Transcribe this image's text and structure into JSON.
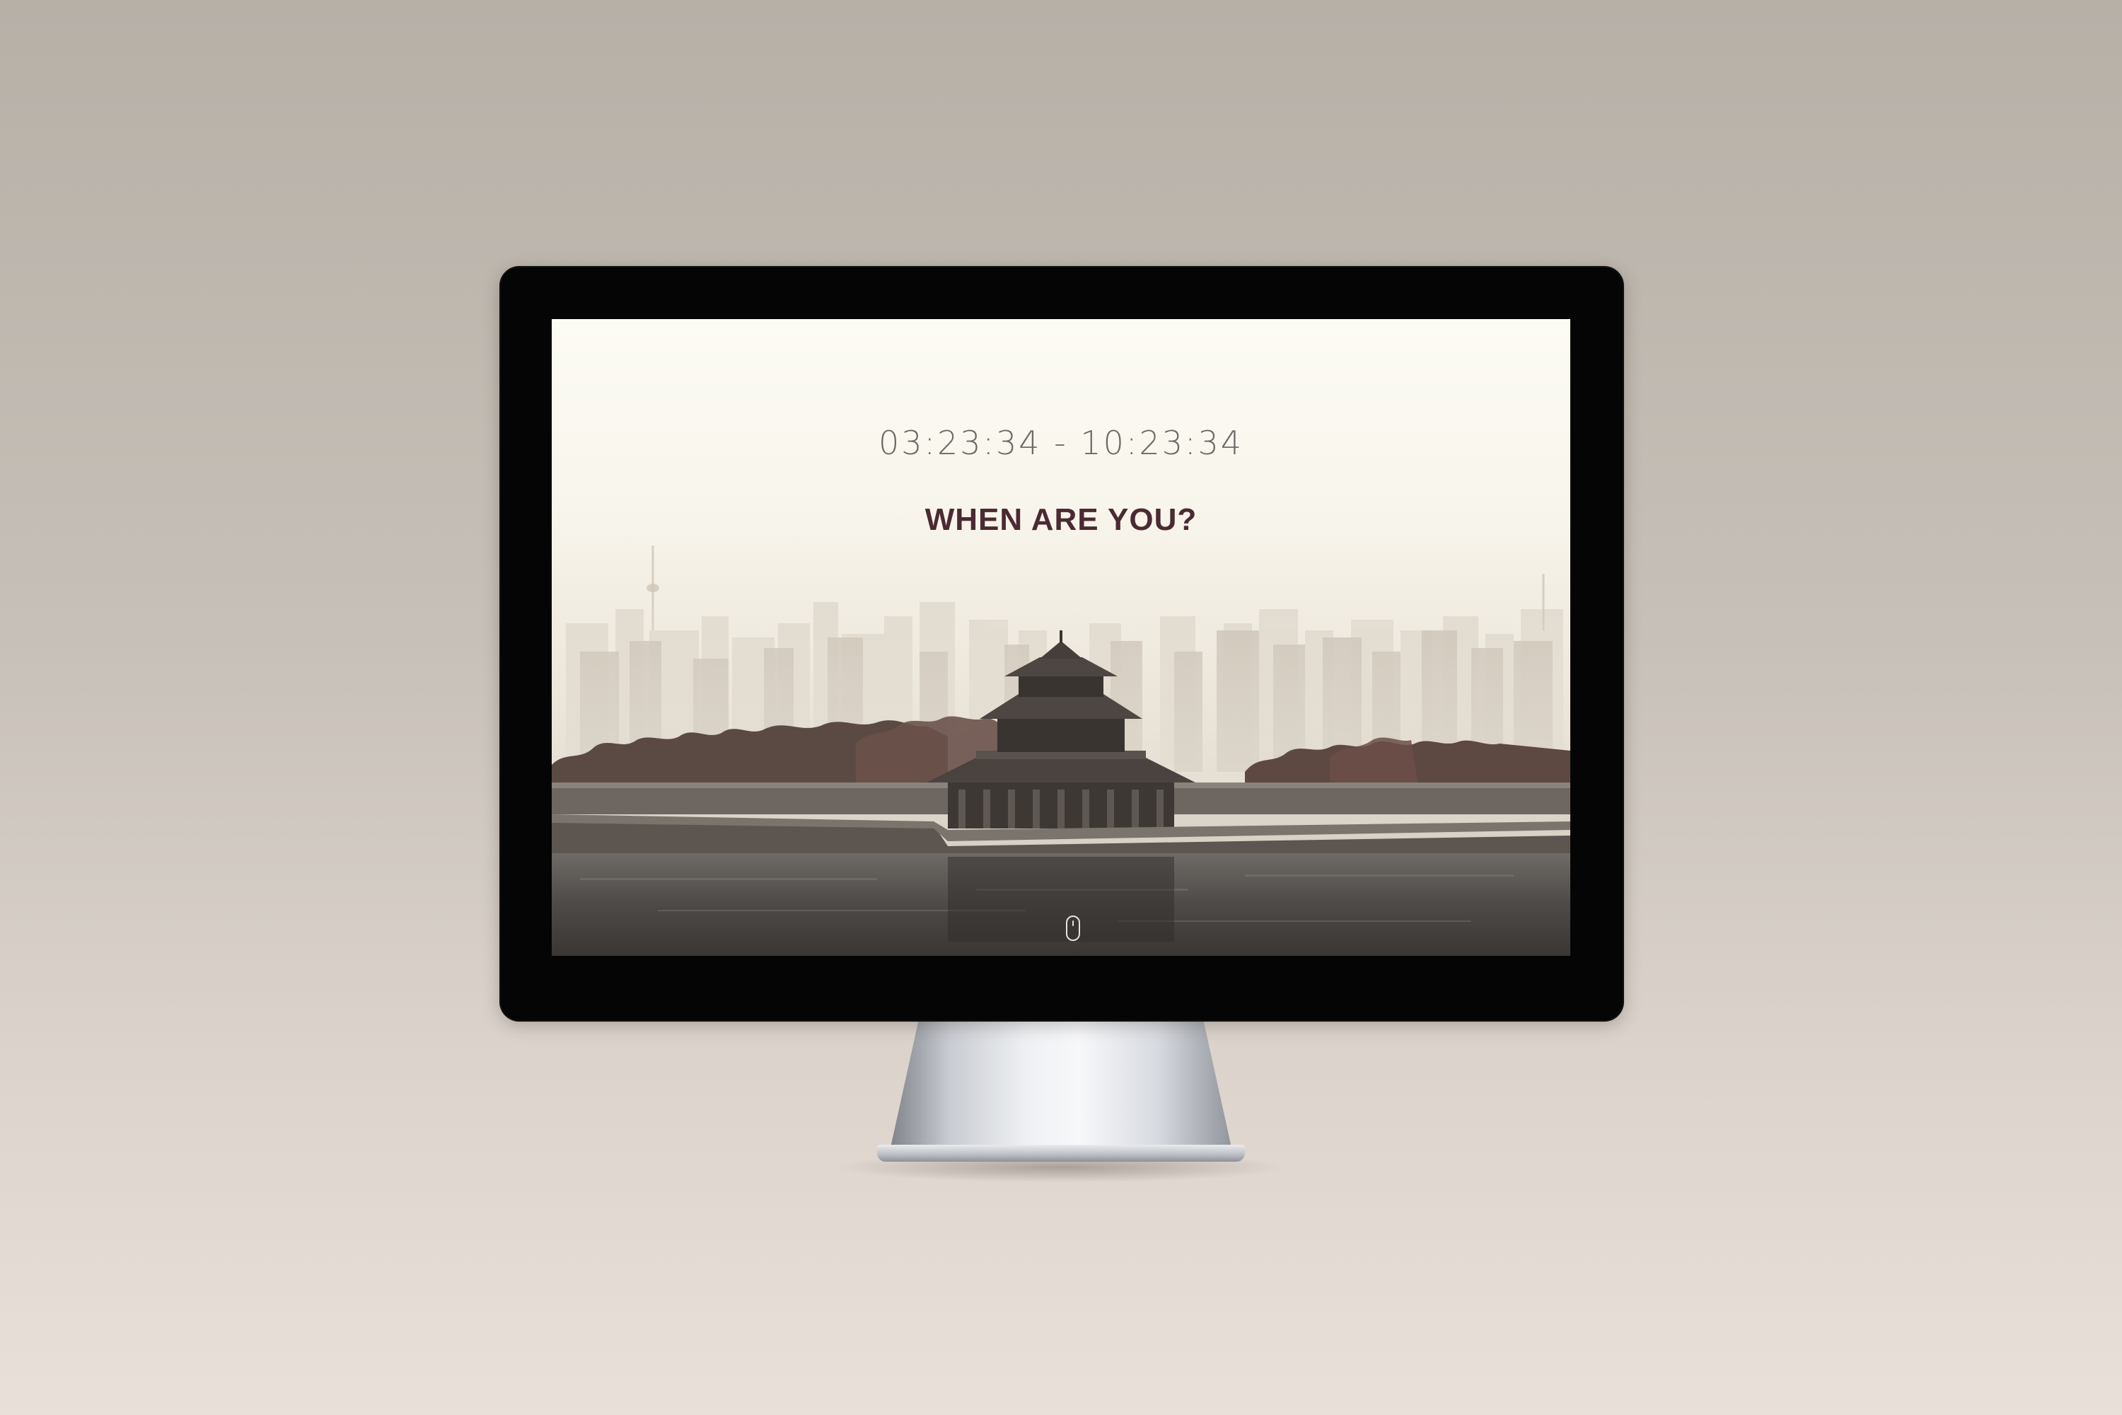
{
  "hero": {
    "time_range": "03:23:34 - 10:23:34",
    "headline": "WHEN ARE YOU?"
  },
  "icons": {
    "scroll": "mouse-scroll-icon"
  },
  "colors": {
    "headline": "#4b2a33",
    "time_text": "#6b6a67",
    "bezel": "#050505",
    "background": "#c7c0b8"
  }
}
